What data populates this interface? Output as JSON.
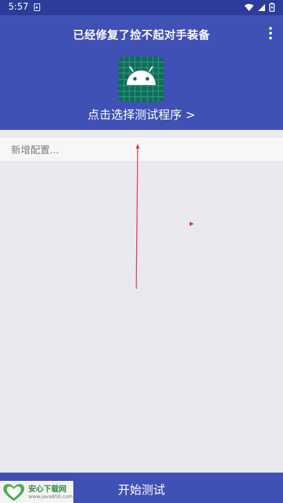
{
  "status_bar": {
    "time": "5:57",
    "icons": [
      "wifi-icon",
      "cellular-signal-icon",
      "battery-charging-icon"
    ]
  },
  "header": {
    "title": "已经修复了捡不起对手装备",
    "select_app_label": "点击选择测试程序 >",
    "app_icon": "android-icon",
    "colors": {
      "primary": "#3f51b5",
      "status_bar": "#2c3c98",
      "app_icon_bg": "#0f6d5b"
    }
  },
  "config": {
    "placeholder": "新增配置..."
  },
  "bottom_bar": {
    "start_label": "开始测试"
  },
  "watermark": {
    "name": "安心下载网",
    "url": "www.java800.com"
  }
}
